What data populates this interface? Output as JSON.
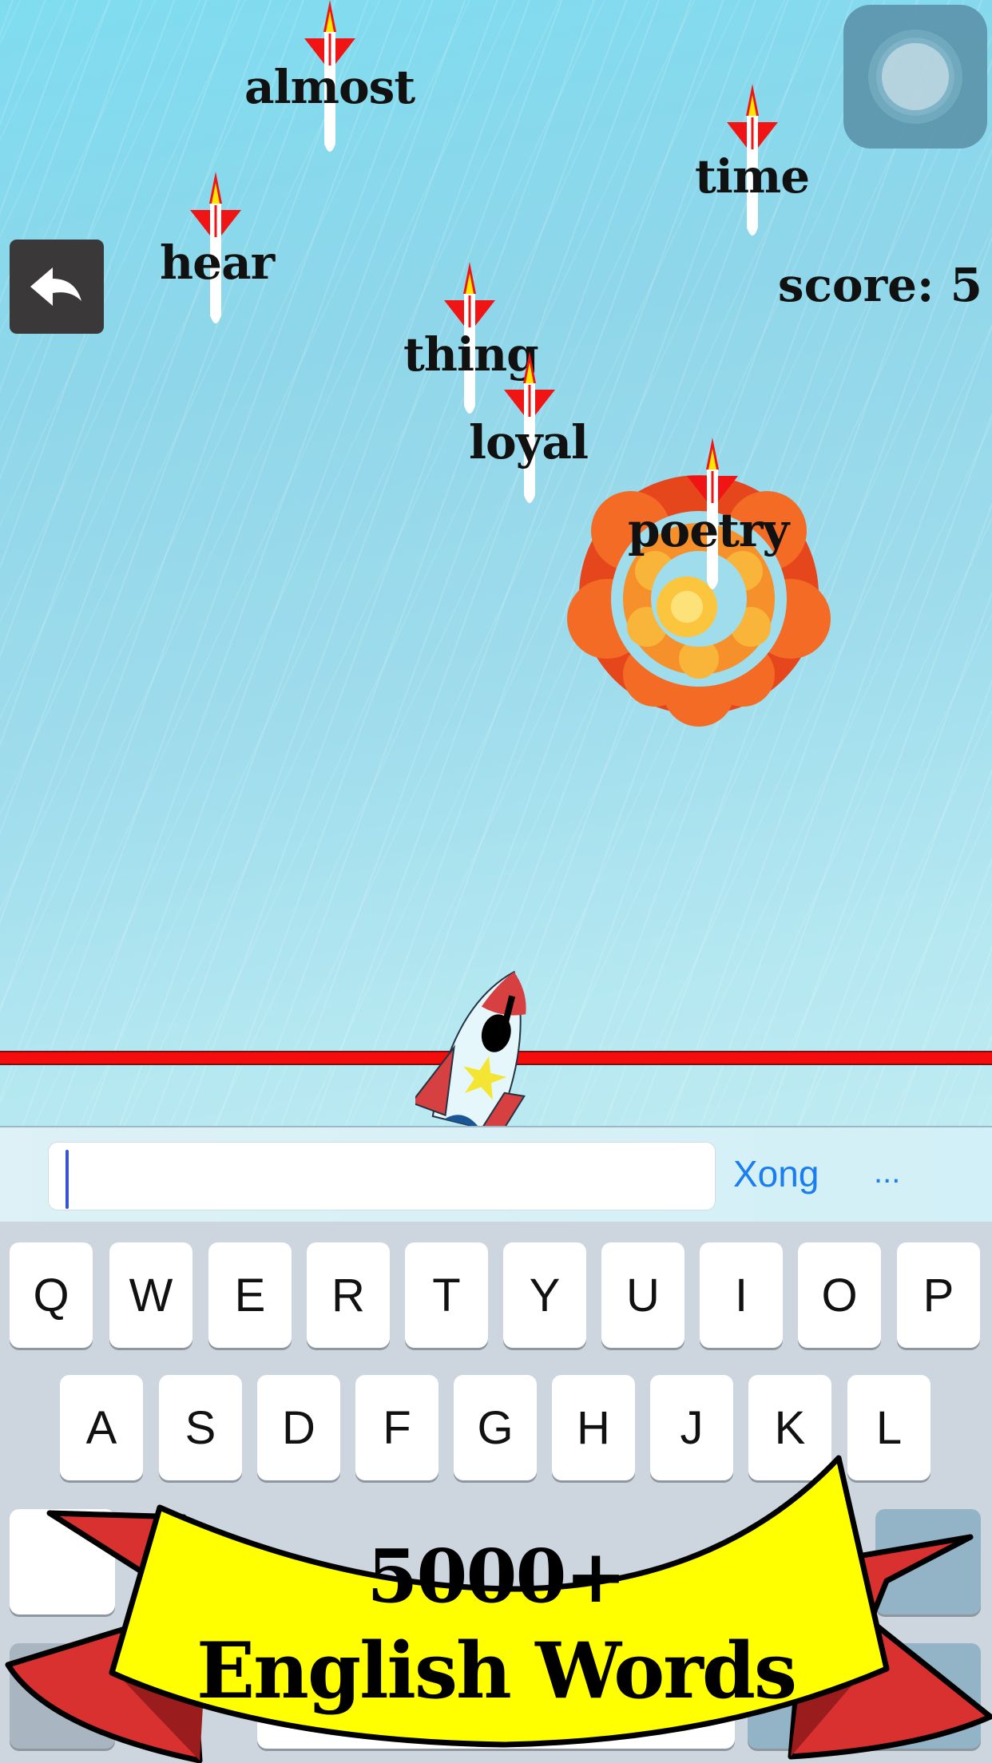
{
  "game": {
    "score_label": "score: 5",
    "score_value": 5,
    "falling_words": [
      {
        "word": "almost"
      },
      {
        "word": "time"
      },
      {
        "word": "hear"
      },
      {
        "word": "thing"
      },
      {
        "word": "loyal"
      },
      {
        "word": "poetry",
        "state": "exploding"
      }
    ],
    "icons": {
      "back": "back-arrow-icon",
      "pause": "assistive-touch-icon",
      "player": "rocket-icon",
      "explosion": "explosion-icon",
      "missile": "missile-icon"
    },
    "colors": {
      "sky": "#8fd6ea",
      "deadline": "#f50d0d",
      "back_button": "#3a3839",
      "missile_fin": "#f01414",
      "flame": "#ffe600"
    }
  },
  "input_bar": {
    "value": "",
    "placeholder": "",
    "done_label": "Xong",
    "more_label": "...",
    "accent": "#1a7ef0"
  },
  "keyboard": {
    "row1": [
      "Q",
      "W",
      "E",
      "R",
      "T",
      "Y",
      "U",
      "I",
      "O",
      "P"
    ],
    "row2": [
      "A",
      "S",
      "D",
      "F",
      "G",
      "H",
      "J",
      "K",
      "L"
    ]
  },
  "banner": {
    "line1": "5000+",
    "line2": "English Words",
    "fill": "#ffff00",
    "ribbon": "#d93030"
  }
}
